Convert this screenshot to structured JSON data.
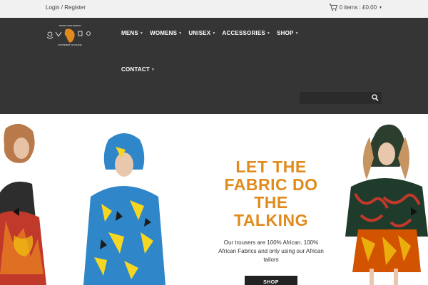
{
  "topbar": {
    "login_label": "Login / Register",
    "cart_label": "0 items : £0.00"
  },
  "logo": {
    "text_top": "SHOW YOUR WORLD",
    "text_bottom": "CONTINENT CLOTHING"
  },
  "nav": {
    "items": [
      {
        "label": "MENS"
      },
      {
        "label": "WOMENS"
      },
      {
        "label": "UNISEX"
      },
      {
        "label": "ACCESSORIES"
      },
      {
        "label": "SHOP"
      }
    ],
    "contact_label": "CONTACT"
  },
  "search": {
    "placeholder": ""
  },
  "hero": {
    "headline_1": "LET THE",
    "headline_2": "FABRIC DO",
    "headline_3": "THE",
    "headline_4": "TALKING",
    "subtext": "Our trousers are 100% African. 100% African Fabrics and only using our African tailors",
    "button_label": "SHOP"
  },
  "colors": {
    "accent": "#e18b1d",
    "header_bg": "#353535",
    "topbar_bg": "#f1f1f1"
  }
}
